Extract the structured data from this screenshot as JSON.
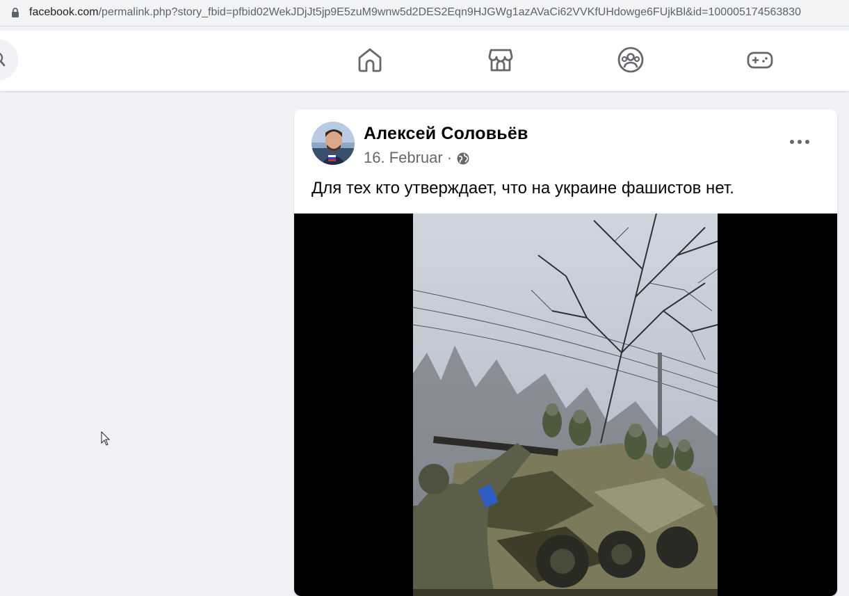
{
  "browser": {
    "url_host": "facebook.com",
    "url_path": "/permalink.php?story_fbid=pfbid02WekJDjJt5jp9E5zuM9wnw5d2DES2Eqn9HJGWg1azAVaCi62VVKfUHdowge6FUjkBl&id=100005174563830",
    "lock_icon": "lock-icon"
  },
  "nav": {
    "search_icon": "search-icon",
    "items": [
      {
        "name": "home",
        "icon": "home-icon"
      },
      {
        "name": "marketplace",
        "icon": "marketplace-icon"
      },
      {
        "name": "groups",
        "icon": "groups-icon"
      },
      {
        "name": "gaming",
        "icon": "gaming-icon"
      }
    ],
    "icon_color": "#65676b"
  },
  "post": {
    "author": "Алексей Соловьёв",
    "date": "16. Februar",
    "separator": "·",
    "audience_icon": "globe-icon",
    "more_icon": "more-options-icon",
    "text": "Для тех кто утверждает, что на украине фашистов нет.",
    "media": "video-frame"
  },
  "colors": {
    "page_bg": "#f0f2f5",
    "card_bg": "#ffffff",
    "primary_text": "#050505",
    "secondary_text": "#65676b"
  }
}
